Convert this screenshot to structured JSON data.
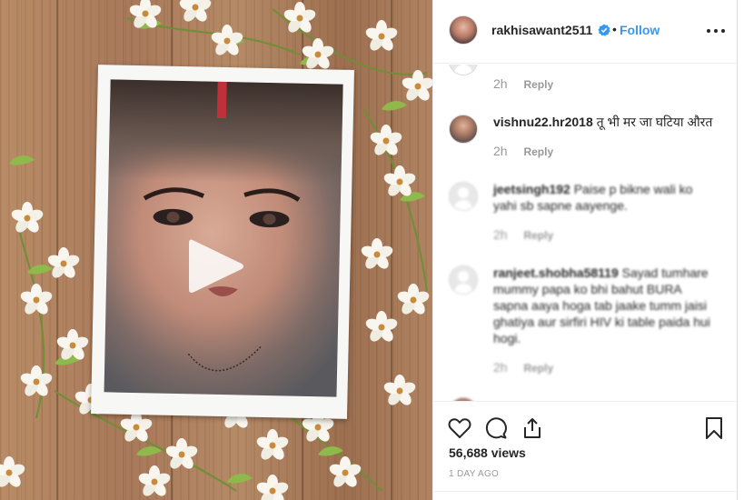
{
  "post": {
    "username": "rakhisawant2511",
    "separator": "•",
    "follow_label": "Follow"
  },
  "comments": [
    {
      "username": "",
      "text": "",
      "time": "2h",
      "reply_label": "Reply"
    },
    {
      "username": "vishnu22.hr2018",
      "text": "तू भी मर जा घटिया औरत",
      "time": "2h",
      "reply_label": "Reply"
    },
    {
      "username": "jeetsingh192",
      "text": "Paise p bikne wali ko yahi sb sapne aayenge.",
      "time": "2h",
      "reply_label": "Reply"
    },
    {
      "username": "ranjeet.shobha58119",
      "text": "Sayad tumhare mummy papa ko bhi bahut BURA sapna aaya hoga tab jaake tumm jaisi ghatiya aur sirfiri HIV ki table paida hui hogi.",
      "time": "2h",
      "reply_label": "Reply"
    }
  ],
  "stats": {
    "views": "56,688 views",
    "posted_ago": "1 DAY AGO"
  },
  "colors": {
    "link_blue": "#3897f0",
    "muted_gray": "#999999",
    "text_dark": "#262626"
  },
  "icons": [
    "verified-badge-icon",
    "more-options-icon",
    "play-icon",
    "heart-icon",
    "comment-icon",
    "share-icon",
    "bookmark-icon"
  ]
}
